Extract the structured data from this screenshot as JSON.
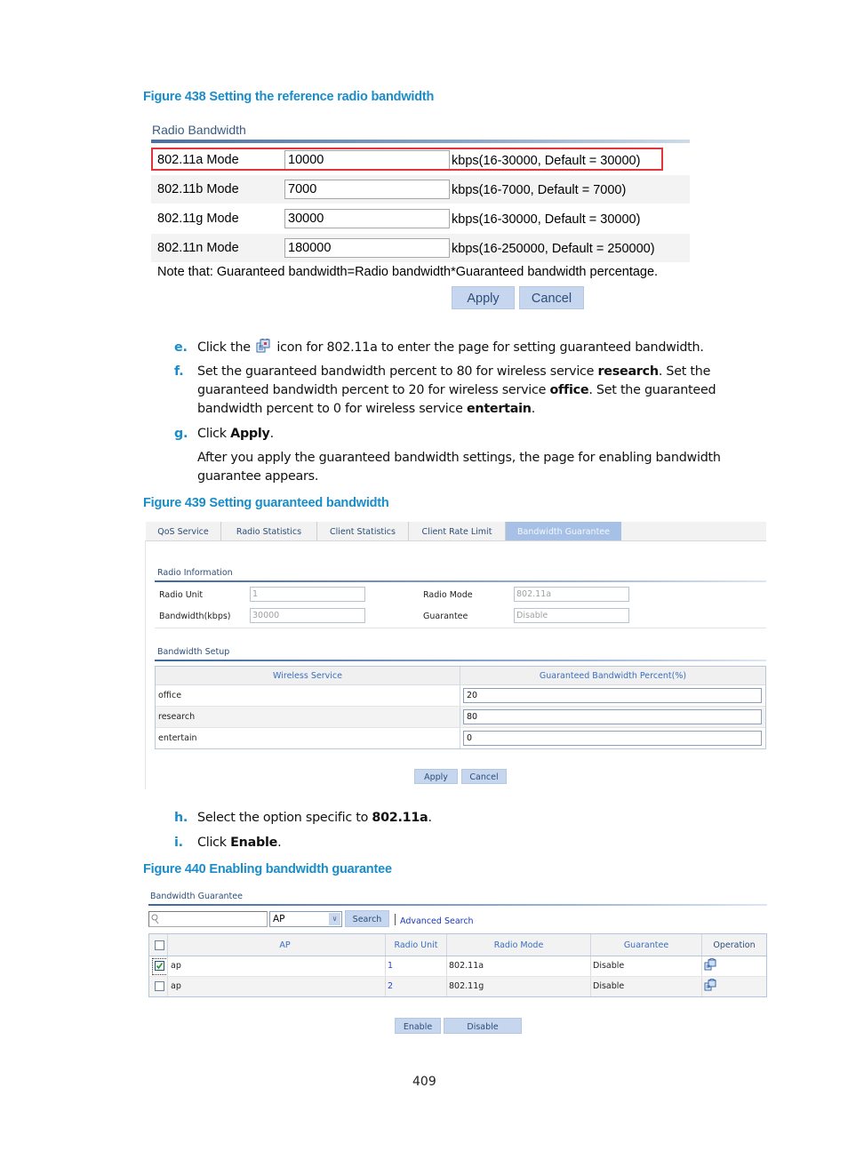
{
  "figure438": {
    "caption": "Figure 438 Setting the reference radio bandwidth",
    "section_title": "Radio Bandwidth",
    "rows": [
      {
        "label": "802.11a Mode",
        "value": "10000",
        "hint": "kbps(16-30000, Default = 30000)",
        "highlighted": true
      },
      {
        "label": "802.11b Mode",
        "value": "7000",
        "hint": "kbps(16-7000, Default = 7000)"
      },
      {
        "label": "802.11g Mode",
        "value": "30000",
        "hint": "kbps(16-30000, Default = 30000)"
      },
      {
        "label": "802.11n Mode",
        "value": "180000",
        "hint": "kbps(16-250000, Default = 250000)"
      }
    ],
    "note": "Note that: Guaranteed bandwidth=Radio bandwidth*Guaranteed bandwidth percentage.",
    "apply_label": "Apply",
    "cancel_label": "Cancel"
  },
  "steps": {
    "e": {
      "marker": "e.",
      "before_icon": "Click the",
      "after_icon": "icon for 802.11a to enter the page for setting guaranteed bandwidth.",
      "icon": "edit-icon"
    },
    "f": {
      "marker": "f.",
      "t1": "Set the guaranteed bandwidth percent to 80 for wireless service ",
      "b1": "research",
      "t2": ". Set the guaranteed bandwidth percent to 20 for wireless service ",
      "b2": "office",
      "t3": ". Set the guaranteed bandwidth percent to 0 for wireless service ",
      "b3": "entertain",
      "t4": "."
    },
    "g": {
      "marker": "g.",
      "t1": "Click ",
      "b1": "Apply",
      "t2": ".",
      "followup": "After you apply the guaranteed bandwidth settings, the page for enabling bandwidth guarantee appears."
    },
    "h": {
      "marker": "h.",
      "t1": "Select the option specific to ",
      "b1": "802.11a",
      "t2": "."
    },
    "i": {
      "marker": "i.",
      "t1": "Click ",
      "b1": "Enable",
      "t2": "."
    }
  },
  "figure439": {
    "caption": "Figure 439 Setting guaranteed bandwidth",
    "tabs": [
      {
        "label": "QoS Service",
        "active": false
      },
      {
        "label": "Radio Statistics",
        "active": false
      },
      {
        "label": "Client Statistics",
        "active": false
      },
      {
        "label": "Client Rate Limit",
        "active": false
      },
      {
        "label": "Bandwidth Guarantee",
        "active": true
      }
    ],
    "radio_info": {
      "title": "Radio Information",
      "radio_unit_label": "Radio Unit",
      "radio_unit_value": "1",
      "bandwidth_label": "Bandwidth(kbps)",
      "bandwidth_value": "30000",
      "radio_mode_label": "Radio Mode",
      "radio_mode_value": "802.11a",
      "guarantee_label": "Guarantee",
      "guarantee_value": "Disable"
    },
    "bandwidth_setup": {
      "title": "Bandwidth Setup",
      "columns": [
        "Wireless Service",
        "Guaranteed Bandwidth Percent(%)"
      ],
      "rows": [
        {
          "service": "office",
          "percent": "20"
        },
        {
          "service": "research",
          "percent": "80"
        },
        {
          "service": "entertain",
          "percent": "0"
        }
      ]
    },
    "apply_label": "Apply",
    "cancel_label": "Cancel"
  },
  "figure440": {
    "caption": "Figure 440 Enabling bandwidth guarantee",
    "section_title": "Bandwidth Guarantee",
    "search": {
      "placeholder": "",
      "field": "AP",
      "search_label": "Search",
      "advanced_label": "Advanced Search"
    },
    "columns": [
      "AP",
      "Radio Unit",
      "Radio Mode",
      "Guarantee",
      "Operation"
    ],
    "rows": [
      {
        "checked": true,
        "ap": "ap",
        "radio_unit": "1",
        "radio_mode": "802.11a",
        "guarantee": "Disable",
        "operation_icon": "edit-icon"
      },
      {
        "checked": false,
        "ap": "ap",
        "radio_unit": "2",
        "radio_mode": "802.11g",
        "guarantee": "Disable",
        "operation_icon": "edit-icon"
      }
    ],
    "enable_label": "Enable",
    "disable_label": "Disable"
  },
  "page_number": "409",
  "colors": {
    "caption": "#1a8cc8",
    "highlight_border": "#e2343b",
    "button_bg": "#c5d6ee",
    "active_tab": "#a7c1e6",
    "link": "#1b38b8"
  }
}
